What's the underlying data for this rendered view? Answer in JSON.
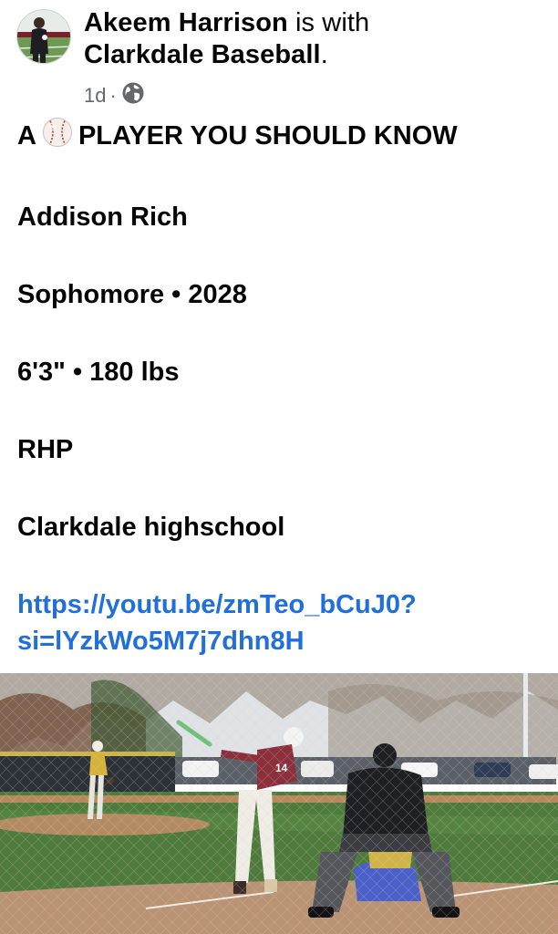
{
  "post": {
    "author": "Akeem Harrison",
    "with_text": "is with",
    "tagged_page": "Clarkdale Baseball",
    "period": ".",
    "time": "1d",
    "separator": "·",
    "audience_icon": "globe-icon"
  },
  "content": {
    "headline_before": "A",
    "headline_emoji": "baseball-icon",
    "headline_after": "PLAYER YOU SHOULD KNOW",
    "name": "Addison Rich",
    "class_year": "Sophomore • 2028",
    "measurements": "6'3\" • 180 lbs",
    "position": "RHP",
    "school": "Clarkdale highschool",
    "link_line1": "https://youtu.be/zmTeo_bCuJ0?",
    "link_line2": "si=lYzkWo5M7j7dhn8H"
  },
  "photo": {
    "subject": "baseball-game-photo",
    "jersey_number": "14"
  },
  "colors": {
    "link": "#216fdb",
    "meta_gray": "#65676b",
    "text": "#050505"
  }
}
